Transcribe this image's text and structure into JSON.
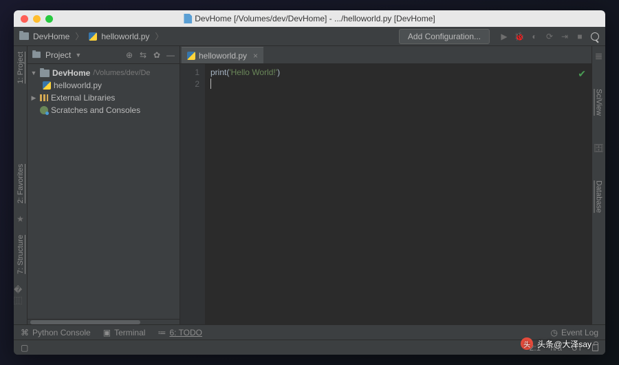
{
  "title": "DevHome [/Volumes/dev/DevHome] - .../helloworld.py [DevHome]",
  "breadcrumb": {
    "root": "DevHome",
    "file": "helloworld.py"
  },
  "toolbar": {
    "add_config": "Add Configuration..."
  },
  "sidebar": {
    "header": "Project",
    "root": {
      "name": "DevHome",
      "path": "/Volumes/dev/De"
    },
    "file": "helloworld.py",
    "external": "External Libraries",
    "scratches": "Scratches and Consoles"
  },
  "left_tool": {
    "project": "1: Project",
    "favorites": "2: Favorites",
    "structure": "7: Structure"
  },
  "right_tool": {
    "sciview": "SciView",
    "database": "Database"
  },
  "tab": {
    "name": "helloworld.py"
  },
  "code": {
    "lines": [
      "1",
      "2"
    ],
    "text_fn": "print",
    "text_paren_open": "(",
    "text_str": "'Hello World!'",
    "text_paren_close": ")"
  },
  "bottom": {
    "console": "Python Console",
    "terminal": "Terminal",
    "todo": "6: TODO",
    "event_log": "Event Log"
  },
  "status": {
    "pos": "2:1",
    "insert": "n/a",
    "encoding": "UT"
  },
  "watermark": "头条@大泽say"
}
